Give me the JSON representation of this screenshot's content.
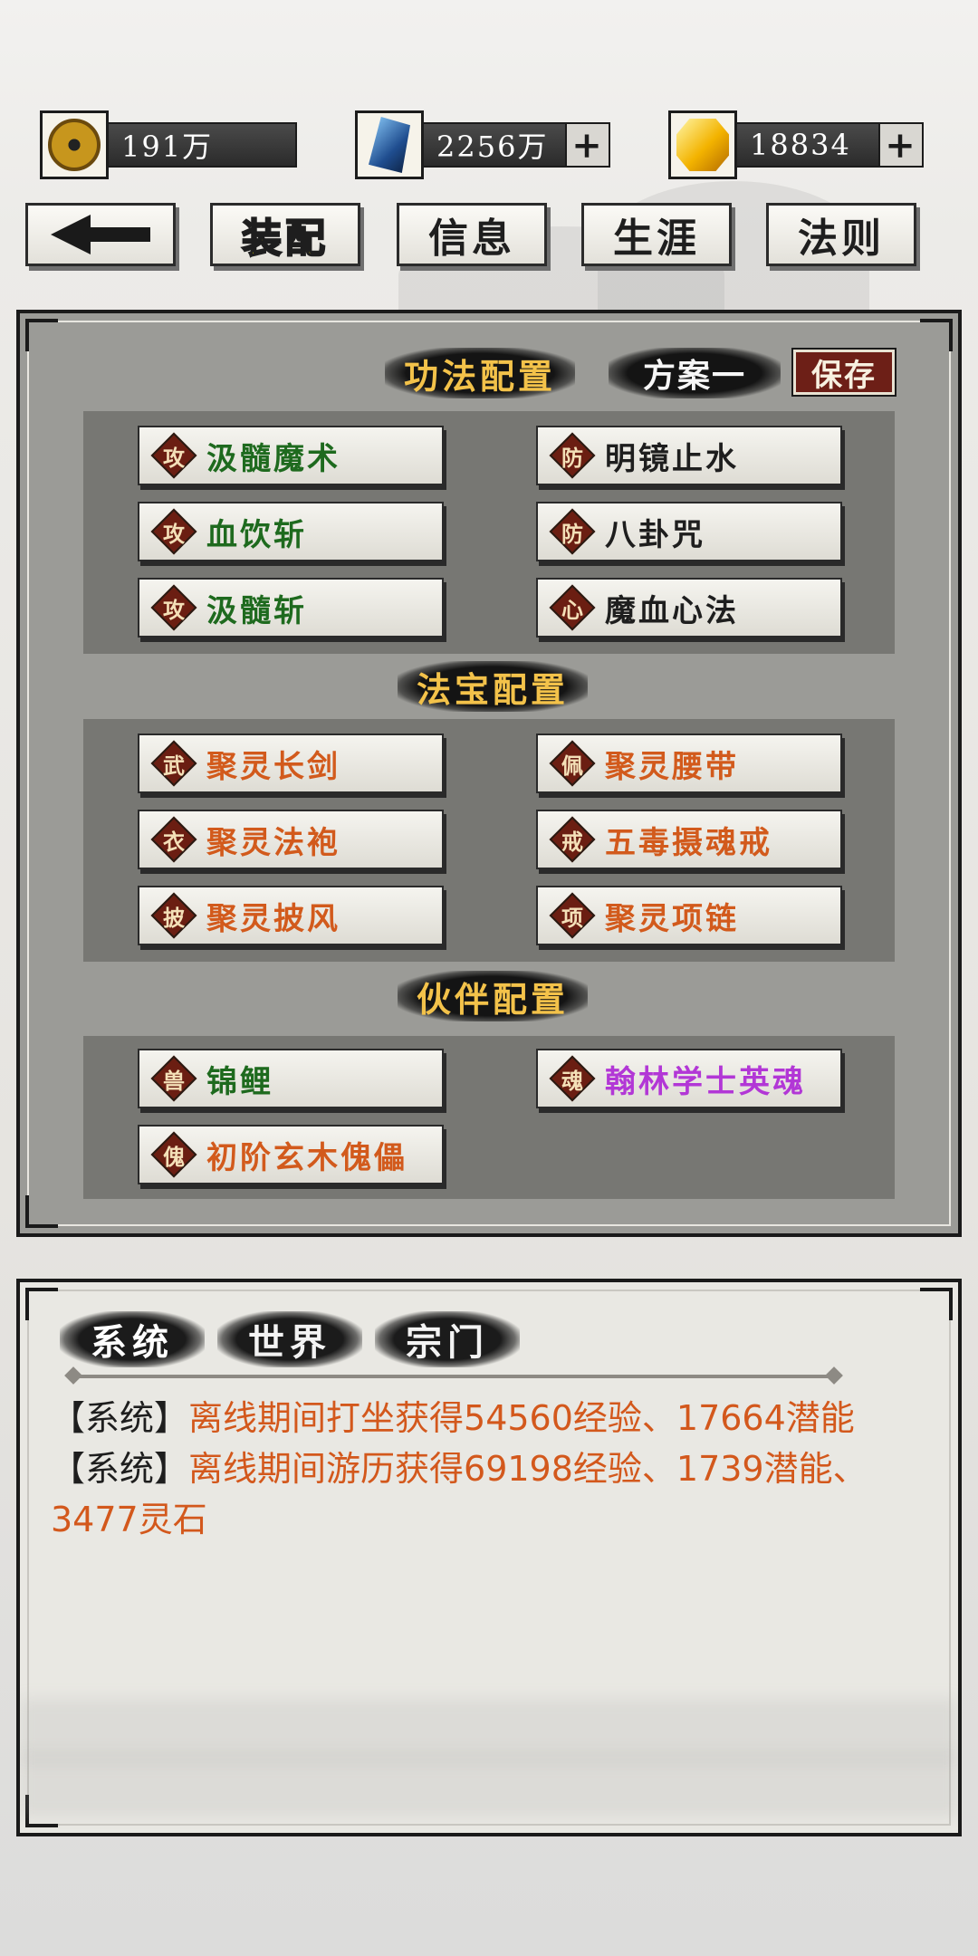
{
  "currencies": [
    {
      "icon": "yinyang-icon",
      "value": "191万",
      "has_plus": false
    },
    {
      "icon": "crystal-icon",
      "value": "2256万",
      "has_plus": true
    },
    {
      "icon": "gold-gem-icon",
      "value": "18834",
      "has_plus": true
    }
  ],
  "nav": {
    "back_icon": "left-arrow-icon",
    "tabs": [
      "装配",
      "信息",
      "生涯",
      "法则"
    ],
    "active_tab": "装配"
  },
  "skills": {
    "title": "功法配置",
    "scheme": "方案一",
    "save": "保存",
    "slots": [
      {
        "tag": "攻",
        "name": "汲髓魔术",
        "color": "#1e6a1e"
      },
      {
        "tag": "防",
        "name": "明镜止水",
        "color": "#1e1e1e"
      },
      {
        "tag": "攻",
        "name": "血饮斩",
        "color": "#1e6a1e"
      },
      {
        "tag": "防",
        "name": "八卦咒",
        "color": "#1e1e1e"
      },
      {
        "tag": "攻",
        "name": "汲髓斩",
        "color": "#1e6a1e"
      },
      {
        "tag": "心",
        "name": "魔血心法",
        "color": "#1e1e1e"
      }
    ]
  },
  "treasures": {
    "title": "法宝配置",
    "slots": [
      {
        "tag": "武",
        "name": "聚灵长剑",
        "color": "#d25a1c"
      },
      {
        "tag": "佩",
        "name": "聚灵腰带",
        "color": "#d25a1c"
      },
      {
        "tag": "衣",
        "name": "聚灵法袍",
        "color": "#d25a1c"
      },
      {
        "tag": "戒",
        "name": "五毒摄魂戒",
        "color": "#d25a1c"
      },
      {
        "tag": "披",
        "name": "聚灵披风",
        "color": "#d25a1c"
      },
      {
        "tag": "项",
        "name": "聚灵项链",
        "color": "#d25a1c"
      }
    ]
  },
  "partners": {
    "title": "伙伴配置",
    "slots": [
      {
        "tag": "兽",
        "name": "锦鲤",
        "color": "#1e6a1e"
      },
      {
        "tag": "魂",
        "name": "翰林学士英魂",
        "color": "#b237d6"
      },
      {
        "tag": "傀",
        "name": "初阶玄木傀儡",
        "color": "#d25a1c"
      }
    ]
  },
  "chat": {
    "tabs": [
      "系统",
      "世界",
      "宗门"
    ],
    "messages": [
      {
        "tag": "【系统】",
        "text": "离线期间打坐获得54560经验、17664潜能"
      },
      {
        "tag": "【系统】",
        "text": "离线期间游历获得69198经验、1739潜能、3477灵石"
      }
    ]
  }
}
